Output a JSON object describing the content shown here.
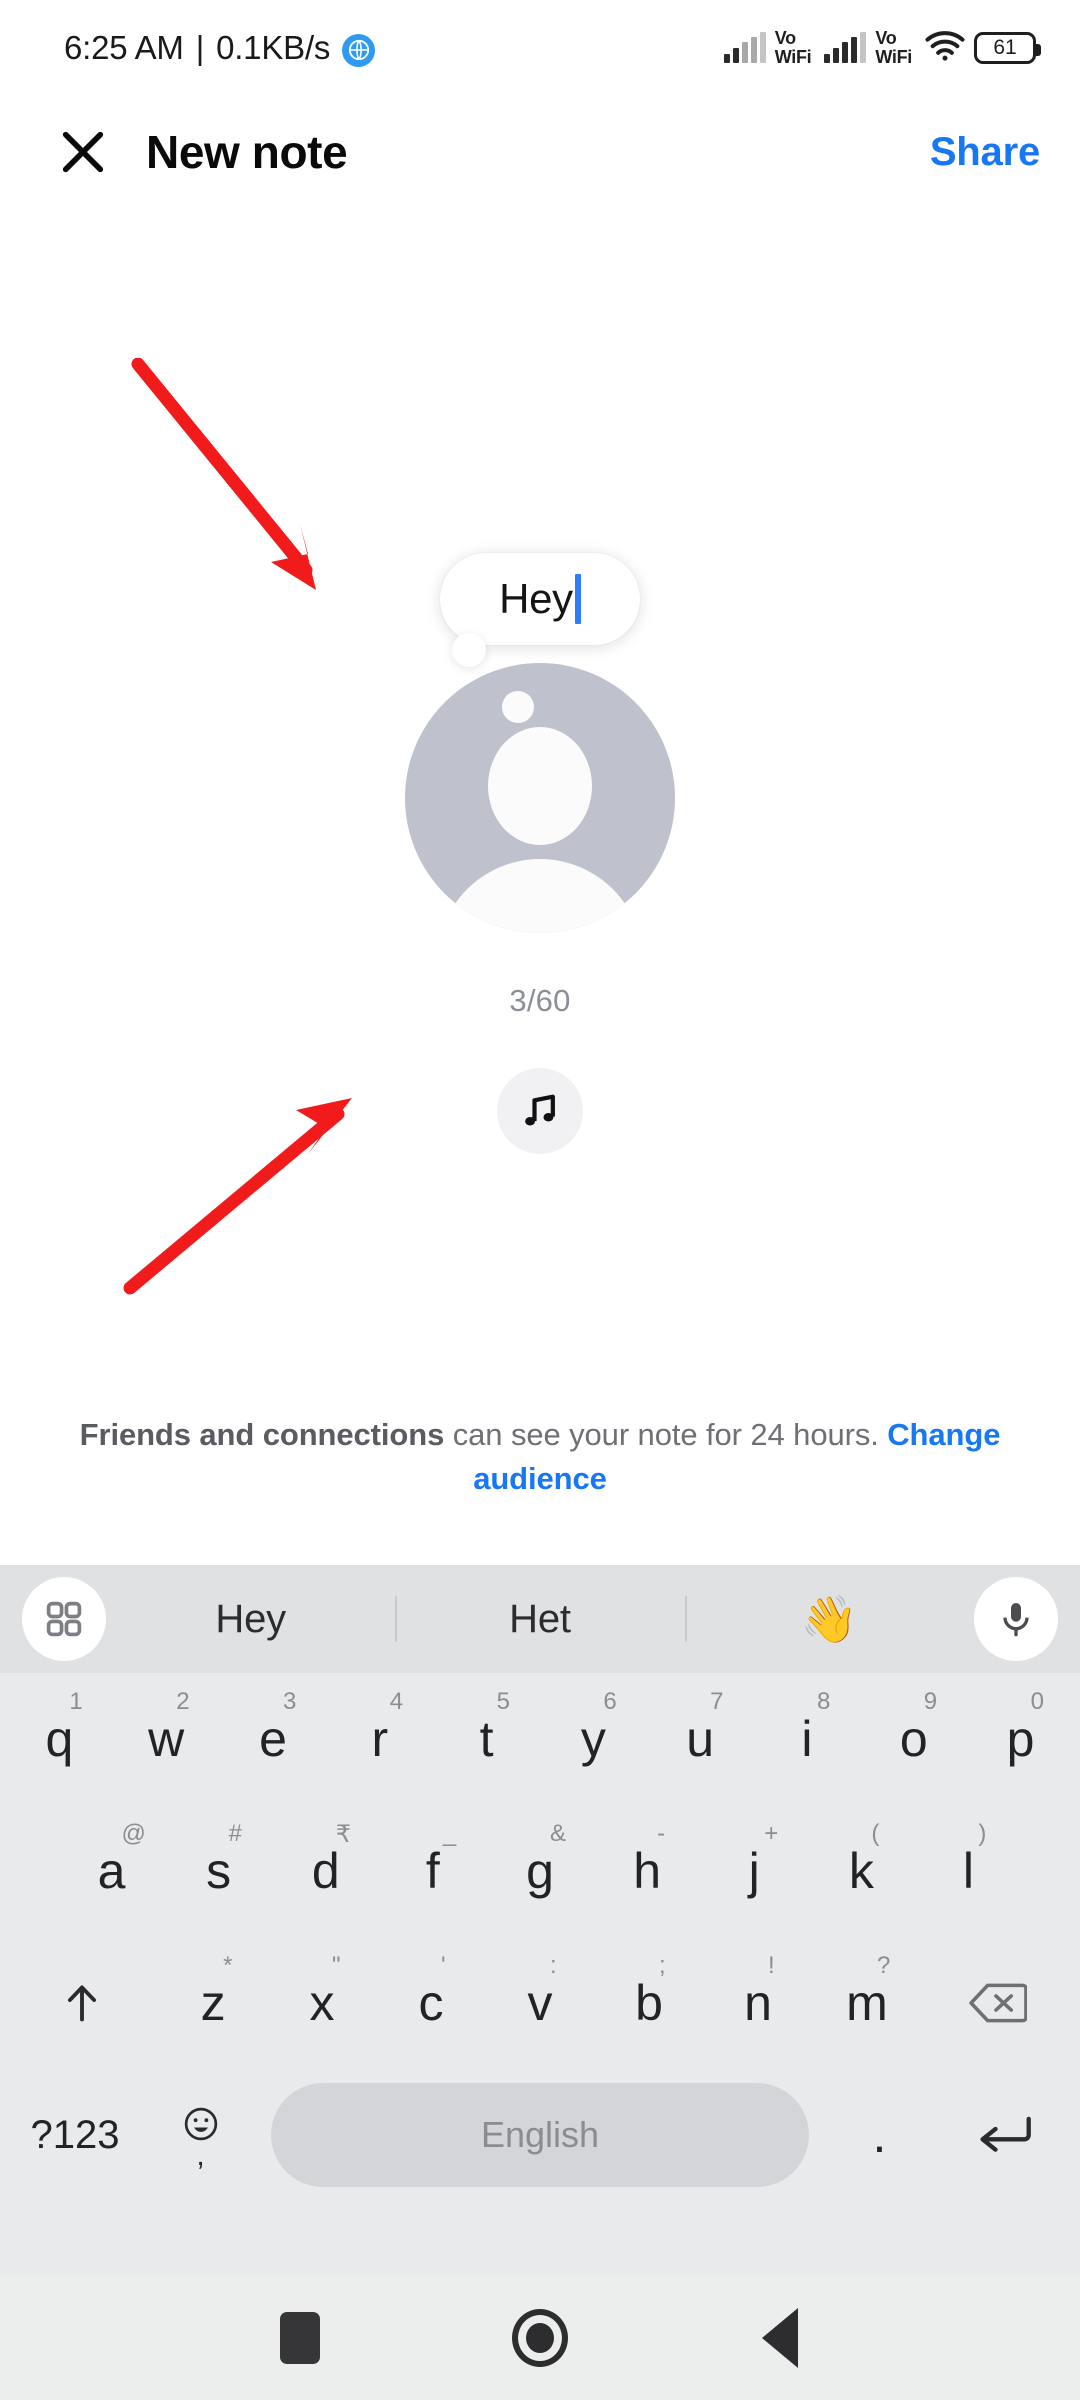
{
  "status_bar": {
    "time": "6:25 AM",
    "separator": "|",
    "network_speed": "0.1KB/s",
    "globe_icon": "globe-icon",
    "sim1_label": "Vo\nWiFi",
    "sim1_line1": "Vo",
    "sim1_line2": "WiFi",
    "sim2_line1": "Vo",
    "sim2_line2": "WiFi",
    "wifi_icon": "wifi-icon",
    "battery_level": "61"
  },
  "header": {
    "close_icon": "close-icon",
    "title": "New note",
    "share_label": "Share"
  },
  "composer": {
    "note_text": "Hey",
    "char_counter": "3/60",
    "avatar_icon": "default-avatar-icon",
    "music_icon": "music-note-icon",
    "audience": {
      "audience_name": "Friends and connections",
      "middle_text": " can see your note for 24 hours. ",
      "change_link": "Change audience"
    }
  },
  "annotations": {
    "arrow_1": "red-arrow-pointing-to-note-bubble",
    "arrow_2": "red-arrow-pointing-to-music-button",
    "arrow_color": "#f21b1b"
  },
  "keyboard": {
    "suggestion_bar": {
      "grid_icon": "grid-menu-icon",
      "suggestions": [
        "Hey",
        "Het"
      ],
      "emoji": "👋",
      "mic_icon": "microphone-icon"
    },
    "row1": [
      {
        "main": "q",
        "alt": "1"
      },
      {
        "main": "w",
        "alt": "2"
      },
      {
        "main": "e",
        "alt": "3"
      },
      {
        "main": "r",
        "alt": "4"
      },
      {
        "main": "t",
        "alt": "5"
      },
      {
        "main": "y",
        "alt": "6"
      },
      {
        "main": "u",
        "alt": "7"
      },
      {
        "main": "i",
        "alt": "8"
      },
      {
        "main": "o",
        "alt": "9"
      },
      {
        "main": "p",
        "alt": "0"
      }
    ],
    "row2": [
      {
        "main": "a",
        "alt": "@"
      },
      {
        "main": "s",
        "alt": "#"
      },
      {
        "main": "d",
        "alt": "₹"
      },
      {
        "main": "f",
        "alt": "_"
      },
      {
        "main": "g",
        "alt": "&"
      },
      {
        "main": "h",
        "alt": "-"
      },
      {
        "main": "j",
        "alt": "+"
      },
      {
        "main": "k",
        "alt": "("
      },
      {
        "main": "l",
        "alt": ")"
      }
    ],
    "row3": [
      {
        "main": "z",
        "alt": "*"
      },
      {
        "main": "x",
        "alt": "\""
      },
      {
        "main": "c",
        "alt": "'"
      },
      {
        "main": "v",
        "alt": ":"
      },
      {
        "main": "b",
        "alt": ";"
      },
      {
        "main": "n",
        "alt": "!"
      },
      {
        "main": "m",
        "alt": "?"
      }
    ],
    "shift_icon": "shift-arrow-icon",
    "backspace_icon": "backspace-icon",
    "symbols_key": "?123",
    "emoji_key_icon": "emoji-face-icon",
    "emoji_key_alt": ",",
    "space_label": "English",
    "period_key": ".",
    "enter_icon": "enter-return-icon"
  },
  "nav_bar": {
    "recents_icon": "recents-square-icon",
    "home_icon": "home-circle-icon",
    "back_icon": "back-triangle-icon"
  }
}
